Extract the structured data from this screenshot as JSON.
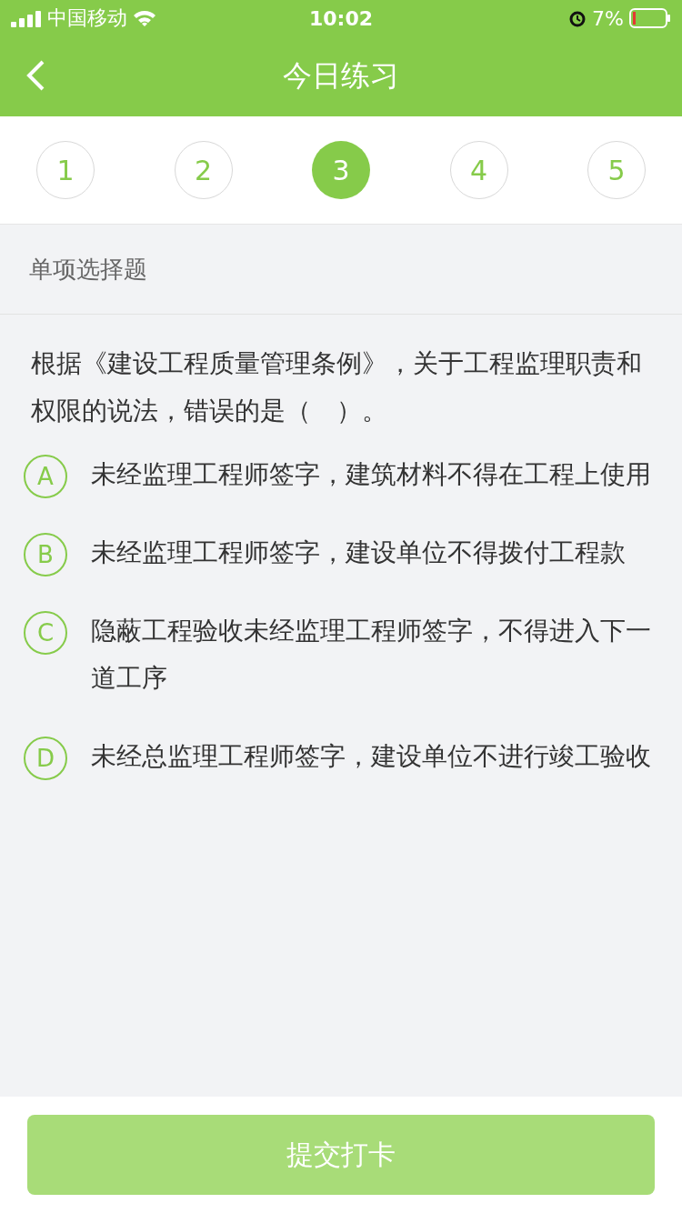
{
  "status_bar": {
    "carrier": "中国移动",
    "time": "10:02",
    "battery": "7%"
  },
  "header": {
    "title": "今日练习"
  },
  "steps": [
    {
      "label": "1",
      "selected": false
    },
    {
      "label": "2",
      "selected": false
    },
    {
      "label": "3",
      "selected": true
    },
    {
      "label": "4",
      "selected": false
    },
    {
      "label": "5",
      "selected": false
    }
  ],
  "section": "单项选择题",
  "question": "根据《建设工程质量管理条例》，关于工程监理职责和权限的说法，错误的是（　）。",
  "options": [
    {
      "letter": "A",
      "text": "未经监理工程师签字，建筑材料不得在工程上使用",
      "selected": false
    },
    {
      "letter": "B",
      "text": "未经监理工程师签字，建设单位不得拨付工程款",
      "selected": false
    },
    {
      "letter": "C",
      "text": "隐蔽工程验收未经监理工程师签字，不得进入下一道工序",
      "selected": false
    },
    {
      "letter": "D",
      "text": "未经总监理工程师签字，建设单位不进行竣工验收",
      "selected": false
    }
  ],
  "submit": {
    "label": "提交打卡",
    "disabled": true
  }
}
